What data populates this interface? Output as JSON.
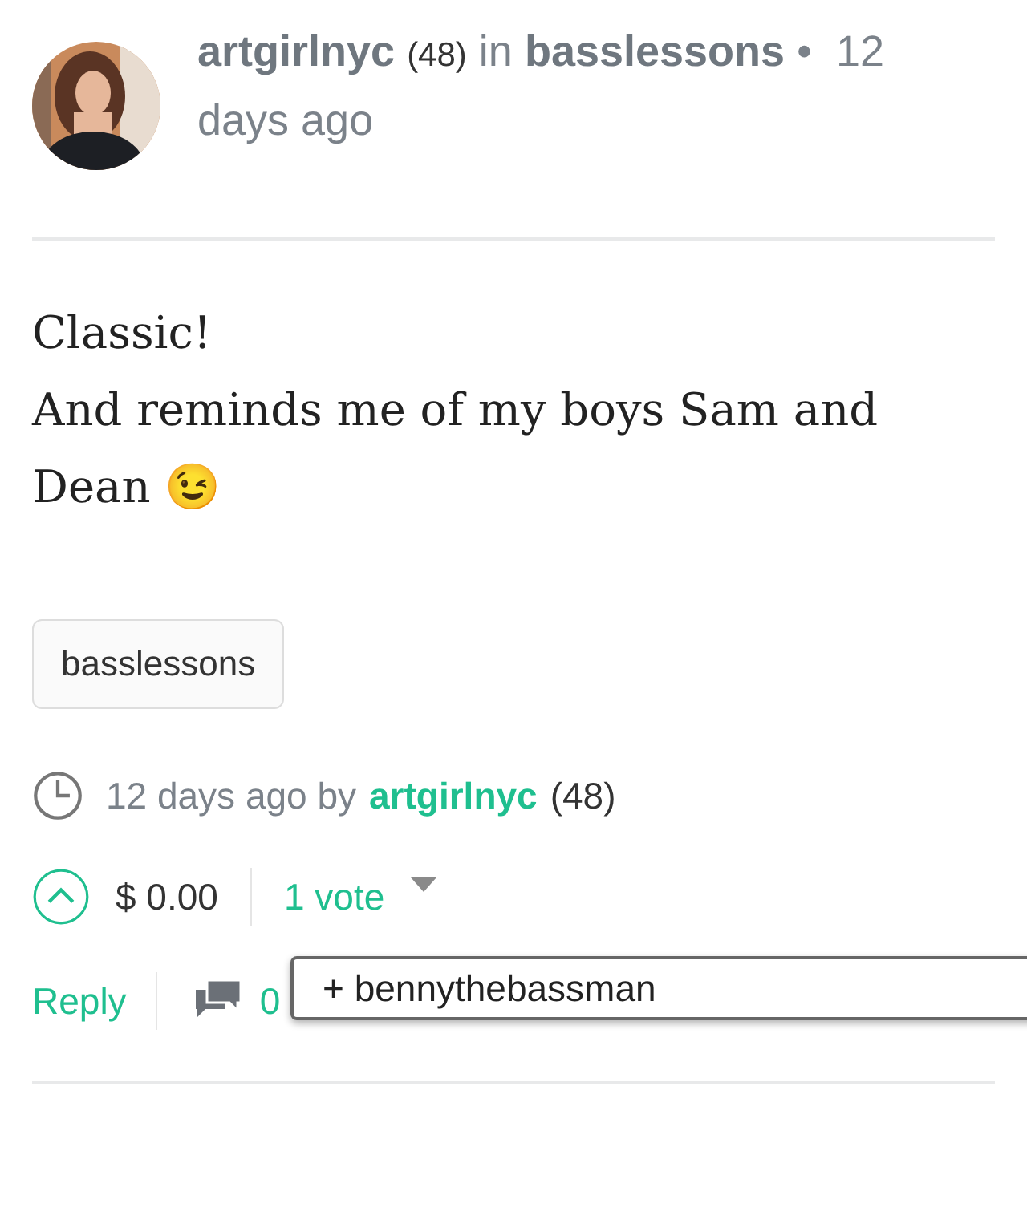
{
  "header": {
    "author": "artgirlnyc",
    "reputation": "(48)",
    "in_word": "in",
    "community": "basslessons",
    "separator": "•",
    "time": "12 days ago"
  },
  "body": [
    "Classic!",
    "And reminds me of my boys Sam and Dean 😉"
  ],
  "tags": [
    "basslessons"
  ],
  "footer": {
    "time": "12 days ago by",
    "author": "artgirlnyc",
    "reputation": "(48)"
  },
  "votes": {
    "upvoted": false,
    "payout": "$ 0.00",
    "vote_count": "1 vote"
  },
  "actions": {
    "reply": "Reply",
    "comments": "0"
  },
  "voter_popup": {
    "items": [
      "+ bennythebassman"
    ]
  }
}
